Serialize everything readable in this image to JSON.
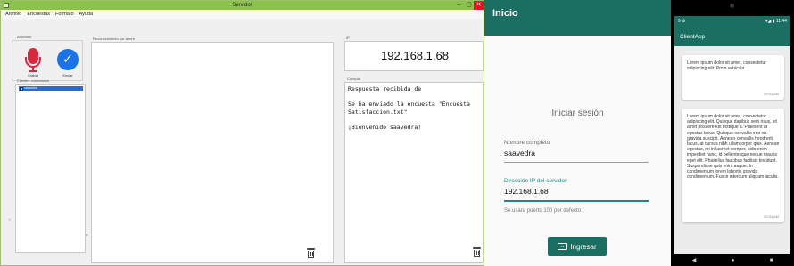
{
  "server_window": {
    "title": "Servidor",
    "controls": {
      "minimize": "–",
      "maximize": "▢",
      "close": "✕"
    },
    "menu": [
      "Archivo",
      "Encuestas",
      "Formato",
      "Ayuda"
    ],
    "acciones_label": "Acciones",
    "grabar_label": "Grabar",
    "enviar_label": "Enviar",
    "clientes_label": "Clientes conectados",
    "clientes": [
      {
        "name": "saavedra",
        "checked": true
      }
    ],
    "reconocimiento_label": "Reconocimiento por Azure",
    "ip_label": "IP",
    "ip_value": "192.168.1.68",
    "consola_label": "Consola",
    "consola_text": "Respuesta recibida de\n\nSe ha enviado la encuesta \"Encuesta Satisfaccion.txt\"\n\n¡Bienvenido saavedra!"
  },
  "login_app": {
    "appbar_title": "Inicio",
    "title": "Iniciar sesión",
    "nombre_label": "Nombre completo",
    "nombre_value": "saavedra",
    "ip_label": "Dirección IP del servidor",
    "ip_value": "192.168.1.68",
    "hint": "Se usara puerto 100 por defecto",
    "button_label": "Ingresar",
    "accent": "#1a6f62"
  },
  "client_app": {
    "status_left": "9 ⚙",
    "status_right": "▾◢ ▮ 11:44",
    "title": "ClientApp",
    "messages": [
      {
        "text": "Lorem ipsum dolor sit amet, consectetur adipiscing elit. Proin vehicula.",
        "time": "00:53 AM"
      },
      {
        "text": "Lorem ipsum dolor sit amet, consectetur adipiscing elit. Quisque dapibus sem risus, sit amet posuere est tristique a. Praesent at egestas lacus. Quisque convallis orci eu gravida suscipit. Aenean convallis hendrerit lacus, at cursus nibh ullamcorper quis. Aenean egestas, mi in laoreet semper, odio enim imperdiet nunc, id pellentesque neque mauris eget elit. Phasellus faucibus facilisis tincidunt. Suspendisse quis enim augue. In condimentum lorem lobortis gravida condimentum. Fusce interdum aliquam iaculis.",
        "time": "00:54 AM"
      }
    ],
    "nav": [
      "◀",
      "●",
      "■"
    ]
  }
}
